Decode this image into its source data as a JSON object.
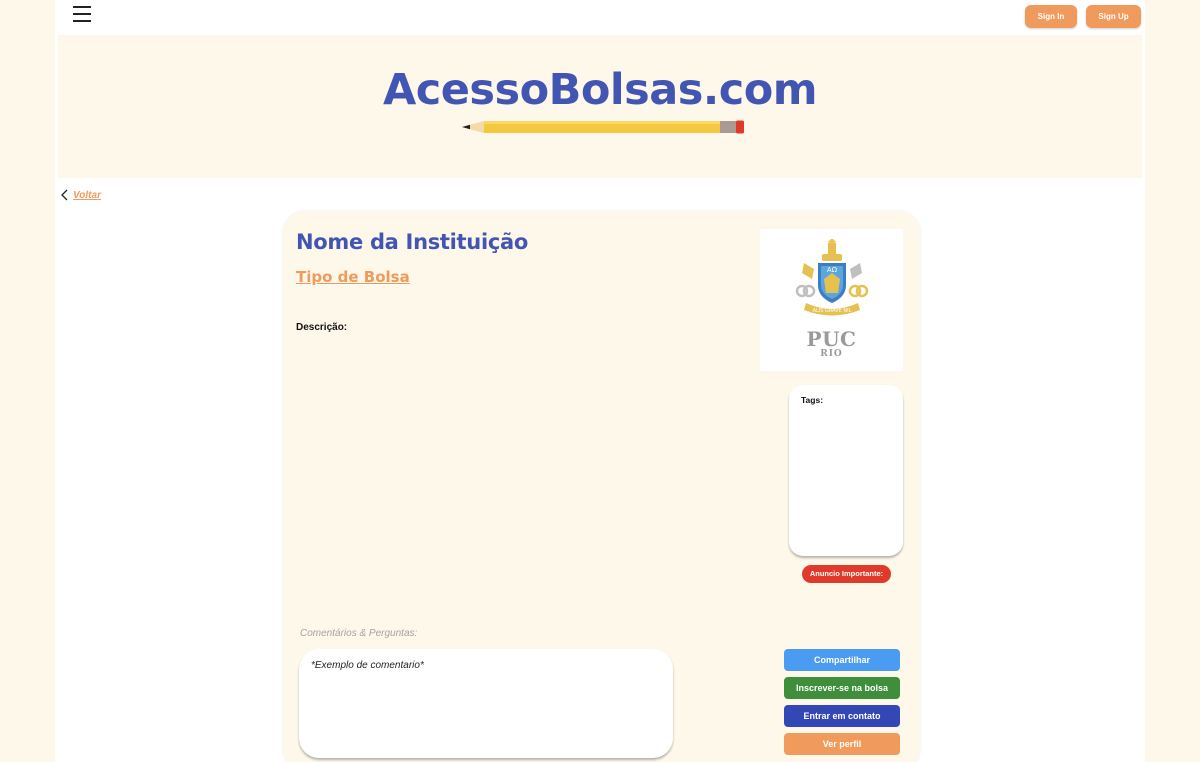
{
  "header": {
    "menu_icon": "hamburger-menu-icon",
    "sign_in_label": "Sign In",
    "sign_up_label": "Sign Up"
  },
  "hero": {
    "site_title": "AcessoBolsas.com",
    "decoration_icon": "pencil-icon"
  },
  "nav": {
    "back_label": "Voltar",
    "back_icon": "chevron-left-icon"
  },
  "scholarship": {
    "institution_name": "Nome da Instituição",
    "bolsa_type": "Tipo de Bolsa",
    "description_label": "Descrição:",
    "logo": {
      "title": "PUC",
      "subtitle": "RIO",
      "shield_letters": "AΩ",
      "ribbon_text": "ALIS GRAVE NIL"
    },
    "tags_label": "Tags:",
    "announcement_label": "Anuncio Importante:"
  },
  "comments": {
    "label": "Comentários & Perguntas:",
    "example_comment": "*Exemplo de comentario*"
  },
  "actions": {
    "share": "Compartilhar",
    "apply": "Inscrever-se na bolsa",
    "contact": "Entrar em contato",
    "profile": "Ver perfil"
  },
  "colors": {
    "background": "#fdf8ea",
    "brand_blue": "#4355b2",
    "accent_orange": "#f09a5c",
    "share_blue": "#4a9bf2",
    "apply_green": "#3e8e3b",
    "contact_navy": "#3348b5",
    "alert_red": "#e03a2b"
  }
}
